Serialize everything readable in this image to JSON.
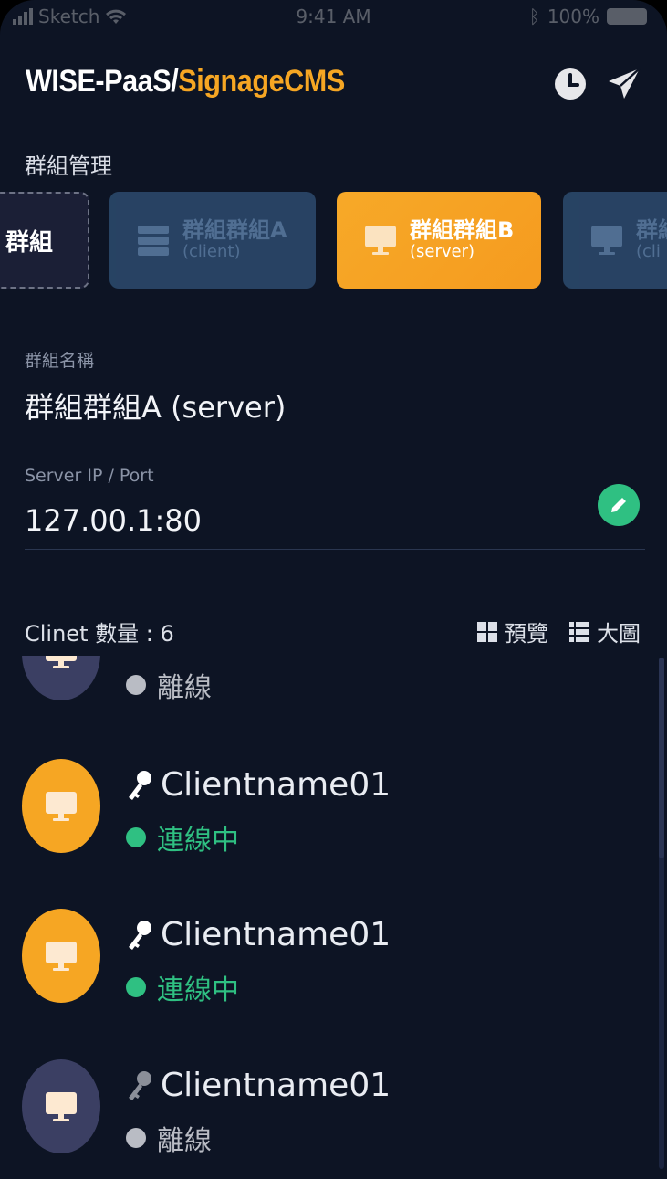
{
  "status_bar": {
    "carrier": "Sketch",
    "time": "9:41 AM",
    "battery": "100%"
  },
  "header": {
    "title_white": "WISE-PaaS/",
    "title_accent": "SignageCMS",
    "history_icon": "clock-icon",
    "send_icon": "paper-plane-icon"
  },
  "section_title": "群組管理",
  "groups": [
    {
      "name": "群組",
      "type": "add"
    },
    {
      "name": "群組群組A",
      "sub": "(client)",
      "icon": "server-icon",
      "selected": false
    },
    {
      "name": "群組群組B",
      "sub": "(server)",
      "icon": "monitor-icon",
      "selected": true
    },
    {
      "name": "群組",
      "sub": "(cli",
      "icon": "monitor-icon",
      "selected": false
    }
  ],
  "form": {
    "name_label": "群組名稱",
    "name_value": "群組群組A (server)",
    "ip_label": "Server IP / Port",
    "ip_value": "127.00.1:80",
    "edit_icon": "pencil-icon"
  },
  "clients": {
    "count_label": "Clinet 數量 : 6",
    "view_preview": "預覽",
    "view_large": "大圖",
    "items": [
      {
        "name": "",
        "status": "離線",
        "online": false
      },
      {
        "name": "Clientname01",
        "status": "連線中",
        "online": true
      },
      {
        "name": "Clientname01",
        "status": "連線中",
        "online": true
      },
      {
        "name": "Clientname01",
        "status": "離線",
        "online": false
      }
    ]
  },
  "colors": {
    "accent": "#f6a623",
    "background": "#0d1424",
    "online": "#2fc082",
    "offline": "#b9bcc4",
    "card_blue": "#2d4b6e"
  }
}
